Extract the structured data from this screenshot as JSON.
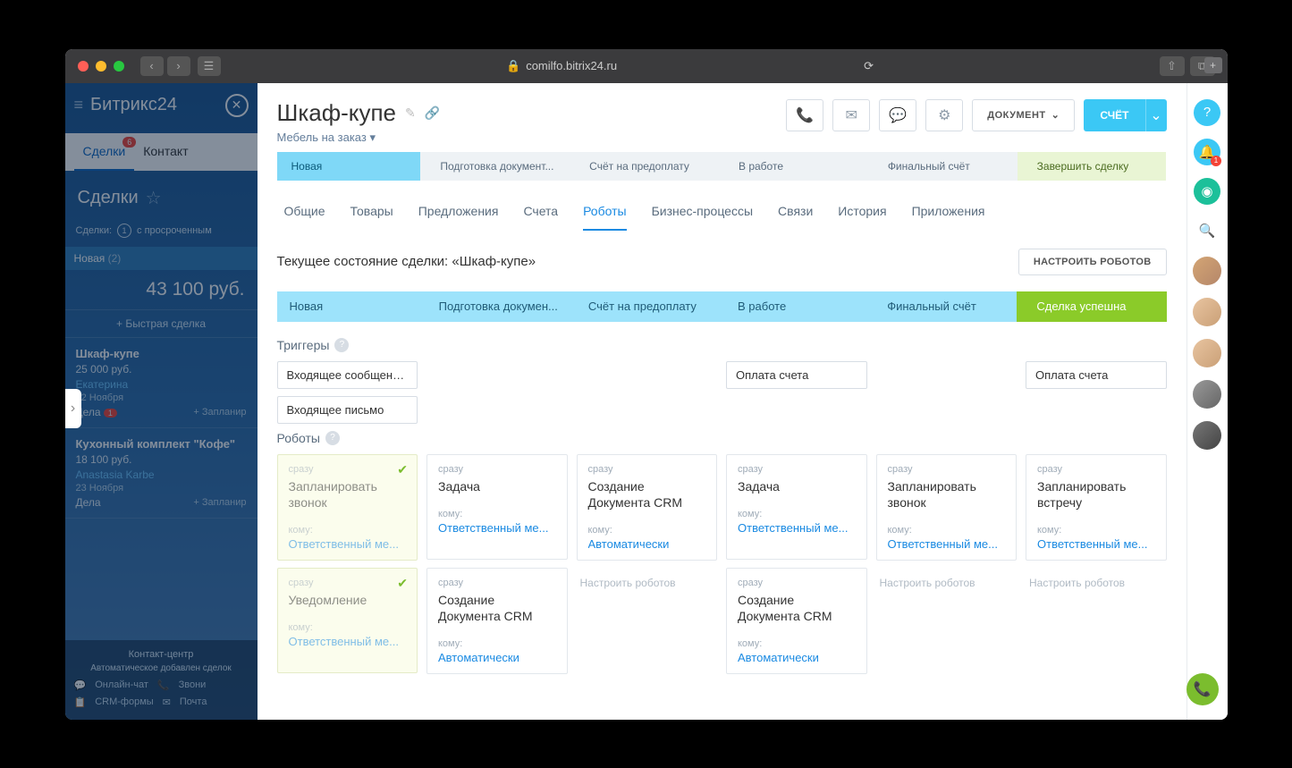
{
  "browser": {
    "url": "comilfo.bitrix24.ru"
  },
  "bitrix": {
    "logo": "Битрикс",
    "logo_suffix": "24",
    "tabs": {
      "deals": "Сделки",
      "contacts": "Контакт",
      "badge": "6"
    },
    "deals_title": "Сделки",
    "meta_label": "Сделки:",
    "meta_num": "1",
    "meta_text": "с просроченным",
    "stage_label": "Новая",
    "stage_count": "(2)",
    "sum": "43 100 руб.",
    "quick": "Быстрая сделка",
    "cards": [
      {
        "title": "Шкаф-купе",
        "price": "25 000 руб.",
        "user": "Екатерина",
        "date": "22 Ноября",
        "dela": "Дела",
        "badge": "1",
        "plan": "+ Запланир"
      },
      {
        "title": "Кухонный комплект \"Кофе\"",
        "price": "18 100 руб.",
        "user": "Anastasia Karbe",
        "date": "23 Ноября",
        "dela": "Дела",
        "plan": "+ Запланир"
      }
    ],
    "overlay": {
      "title": "Контакт-центр",
      "sub": "Автоматическое добавлен сделок",
      "chat": "Онлайн-чат",
      "call": "Звони",
      "forms": "CRM-формы",
      "mail": "Почта"
    }
  },
  "deal": {
    "title": "Шкаф-купе",
    "subtitle": "Мебель на заказ",
    "doc_btn": "ДОКУМЕНТ",
    "bill_btn": "СЧЁТ",
    "stages": [
      "Новая",
      "Подготовка документ...",
      "Счёт на предоплату",
      "В работе",
      "Финальный счёт",
      "Завершить сделку"
    ],
    "tabs": [
      "Общие",
      "Товары",
      "Предложения",
      "Счета",
      "Роботы",
      "Бизнес-процессы",
      "Связи",
      "История",
      "Приложения"
    ],
    "active_tab": 4,
    "status_label": "Текущее состояние сделки: «Шкаф-купе»",
    "config_btn": "НАСТРОИТЬ РОБОТОВ",
    "mini_stages": [
      "Новая",
      "Подготовка докумен...",
      "Счёт на предоплату",
      "В работе",
      "Финальный счёт",
      "Сделка успешна"
    ],
    "triggers_label": "Триггеры",
    "robots_label": "Роботы",
    "triggers": {
      "c0": [
        "Входящее сообщени...",
        "Входящее письмо"
      ],
      "c3": [
        "Оплата счета"
      ],
      "c5": [
        "Оплата счета"
      ]
    },
    "empty_hint": "Настроить роботов",
    "time_label": "сразу",
    "to_label": "кому:",
    "robots": {
      "c0": [
        {
          "title": "Запланировать звонок",
          "who": "Ответственный ме...",
          "done": true
        },
        {
          "title": "Уведомление",
          "who": "Ответственный ме...",
          "done": true
        }
      ],
      "c1": [
        {
          "title": "Задача",
          "who": "Ответственный ме..."
        },
        {
          "title": "Создание Документа CRM",
          "who": "Автоматически"
        }
      ],
      "c2": [
        {
          "title": "Создание Документа CRM",
          "who": "Автоматически"
        }
      ],
      "c3": [
        {
          "title": "Задача",
          "who": "Ответственный ме..."
        },
        {
          "title": "Создание Документа CRM",
          "who": "Автоматически"
        }
      ],
      "c4": [
        {
          "title": "Запланировать звонок",
          "who": "Ответственный ме..."
        }
      ],
      "c5": [
        {
          "title": "Запланировать встречу",
          "who": "Ответственный ме..."
        }
      ]
    }
  },
  "rightbar": {
    "notif": "1"
  }
}
